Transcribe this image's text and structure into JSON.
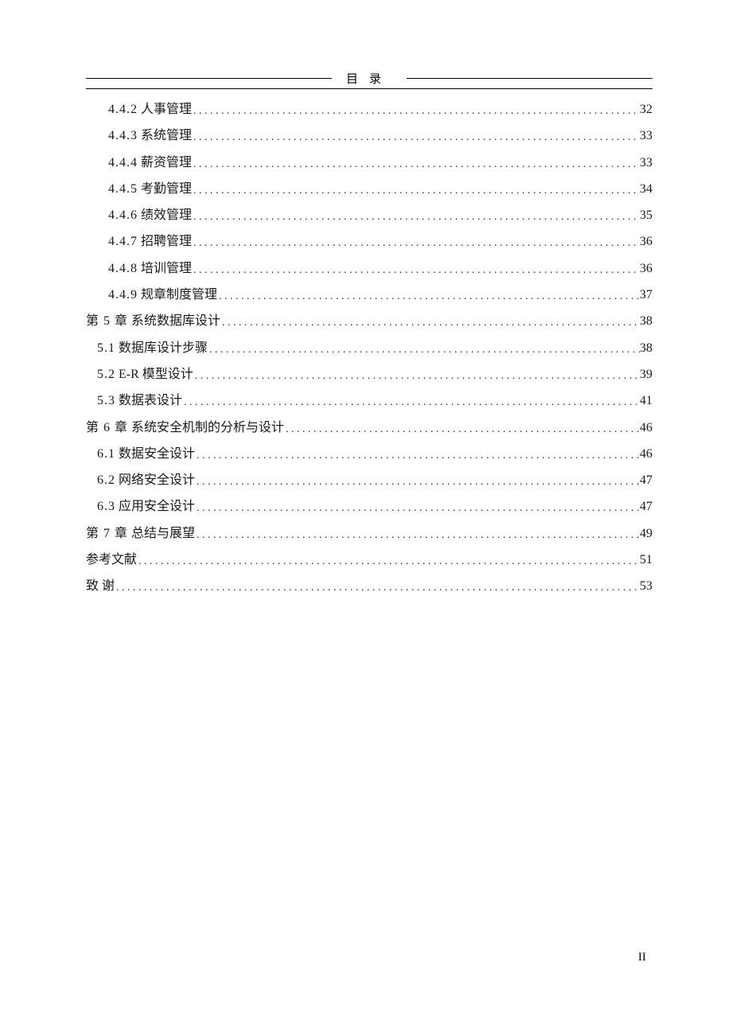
{
  "header_title": "目录",
  "page_footer": "II",
  "toc": [
    {
      "level": 3,
      "num": "4.4.2",
      "title": "人事管理",
      "page": "32"
    },
    {
      "level": 3,
      "num": "4.4.3",
      "title": "系统管理",
      "page": "33"
    },
    {
      "level": 3,
      "num": "4.4.4",
      "title": "薪资管理",
      "page": "33"
    },
    {
      "level": 3,
      "num": "4.4.5",
      "title": "考勤管理",
      "page": "34"
    },
    {
      "level": 3,
      "num": "4.4.6",
      "title": "绩效管理",
      "page": "35"
    },
    {
      "level": 3,
      "num": "4.4.7",
      "title": "招聘管理",
      "page": "36"
    },
    {
      "level": 3,
      "num": "4.4.8",
      "title": "培训管理",
      "page": "36"
    },
    {
      "level": 3,
      "num": "4.4.9",
      "title": "规章制度管理",
      "page": "37"
    },
    {
      "level": 1,
      "num": "第 5 章",
      "title": " 系统数据库设计",
      "page": "38",
      "gap": true
    },
    {
      "level": 2,
      "num": "5.1",
      "title": "数据库设计步骤",
      "page": "38",
      "gap": true
    },
    {
      "level": 2,
      "num": "5.2",
      "title": "E-R 模型设计",
      "page": "39"
    },
    {
      "level": 2,
      "num": "5.3",
      "title": "数据表设计 ",
      "page": "41"
    },
    {
      "level": 1,
      "num": "第 6 章",
      "title": " 系统安全机制的分析与设计",
      "page": "46",
      "gap": true
    },
    {
      "level": 2,
      "num": "6.1",
      "title": "数据安全设计",
      "page": "46",
      "gap": true
    },
    {
      "level": 2,
      "num": "6.2",
      "title": "网络安全设计",
      "page": "47"
    },
    {
      "level": 2,
      "num": "6.3",
      "title": "应用安全设计",
      "page": "47"
    },
    {
      "level": 1,
      "num": "第 7 章",
      "title": " 总结与展望",
      "page": "49",
      "gap": true
    },
    {
      "level": 1,
      "num": "",
      "title": "参考文献",
      "page": "51",
      "gap": true
    },
    {
      "level": 1,
      "num": "",
      "title": "致 谢",
      "page": "53",
      "gap": true
    }
  ]
}
